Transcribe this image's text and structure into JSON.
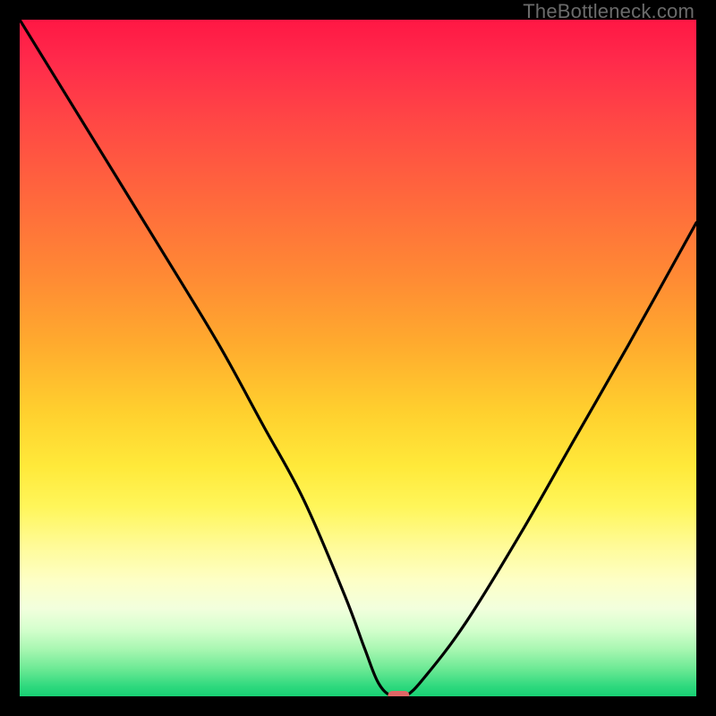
{
  "watermark": "TheBottleneck.com",
  "chart_data": {
    "type": "line",
    "title": "",
    "xlabel": "",
    "ylabel": "",
    "xlim": [
      0,
      100
    ],
    "ylim": [
      0,
      100
    ],
    "grid": false,
    "legend": false,
    "series": [
      {
        "name": "bottleneck-curve",
        "x": [
          0,
          8,
          16,
          24,
          30,
          36,
          42,
          48,
          51,
          53,
          55,
          57,
          60,
          66,
          74,
          82,
          90,
          100
        ],
        "values": [
          100,
          87,
          74,
          61,
          51,
          40,
          29,
          15,
          7,
          2,
          0,
          0,
          3,
          11,
          24,
          38,
          52,
          70
        ]
      }
    ],
    "marker": {
      "x": 56,
      "y": 0,
      "color": "#e06666"
    },
    "gradient_stops": [
      {
        "offset": 0,
        "color": "#ff1744"
      },
      {
        "offset": 0.5,
        "color": "#ffab2e"
      },
      {
        "offset": 0.72,
        "color": "#fff65a"
      },
      {
        "offset": 0.88,
        "color": "#f2ffdd"
      },
      {
        "offset": 1.0,
        "color": "#18d074"
      }
    ]
  }
}
